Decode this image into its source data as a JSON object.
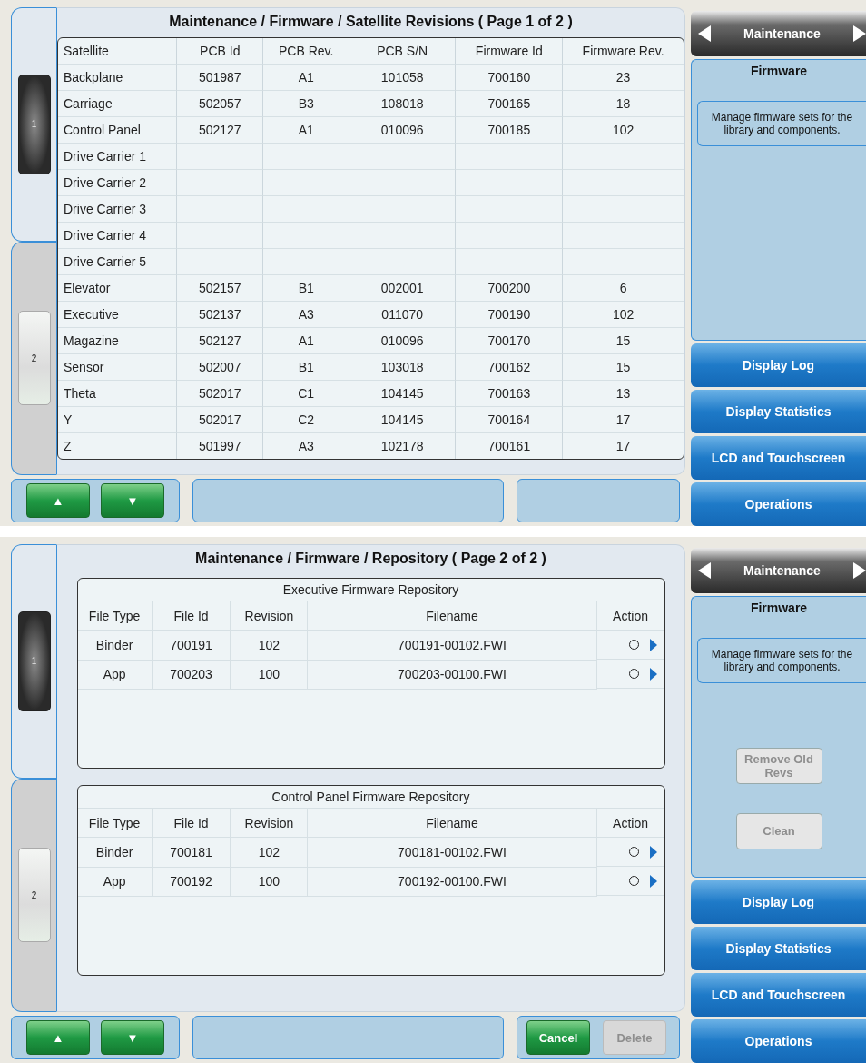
{
  "screens": [
    {
      "title": "Maintenance / Firmware / Satellite Revisions ( Page 1 of 2 )",
      "page_tabs": [
        {
          "label": "1",
          "selected": true
        },
        {
          "label": "2",
          "selected": false
        }
      ],
      "nav_buttons": [
        "▲",
        "▼"
      ],
      "content": {
        "kind": "table",
        "columns": [
          "Satellite",
          "PCB Id",
          "PCB Rev.",
          "PCB S/N",
          "Firmware Id",
          "Firmware Rev."
        ],
        "rows": [
          [
            "Backplane",
            "501987",
            "A1",
            "101058",
            "700160",
            "23"
          ],
          [
            "Carriage",
            "502057",
            "B3",
            "108018",
            "700165",
            "18"
          ],
          [
            "Control Panel",
            "502127",
            "A1",
            "010096",
            "700185",
            "102"
          ],
          [
            "Drive Carrier 1",
            "",
            "",
            "",
            "",
            ""
          ],
          [
            "Drive Carrier 2",
            "",
            "",
            "",
            "",
            ""
          ],
          [
            "Drive Carrier 3",
            "",
            "",
            "",
            "",
            ""
          ],
          [
            "Drive Carrier 4",
            "",
            "",
            "",
            "",
            ""
          ],
          [
            "Drive Carrier 5",
            "",
            "",
            "",
            "",
            ""
          ],
          [
            "Elevator",
            "502157",
            "B1",
            "002001",
            "700200",
            "6"
          ],
          [
            "Executive",
            "502137",
            "A3",
            "011070",
            "700190",
            "102"
          ],
          [
            "Magazine",
            "502127",
            "A1",
            "010096",
            "700170",
            "15"
          ],
          [
            "Sensor",
            "502007",
            "B1",
            "103018",
            "700162",
            "15"
          ],
          [
            "Theta",
            "502017",
            "C1",
            "104145",
            "700163",
            "13"
          ],
          [
            "Y",
            "502017",
            "C2",
            "104145",
            "700164",
            "17"
          ],
          [
            "Z",
            "501997",
            "A3",
            "102178",
            "700161",
            "17"
          ]
        ]
      },
      "side": {
        "section": "Maintenance",
        "heading": "Firmware",
        "description": "Manage firmware sets for the library and components.",
        "menu": [
          "Display Log",
          "Display Statistics",
          "LCD and Touchscreen",
          "Operations"
        ]
      }
    },
    {
      "title": "Maintenance / Firmware / Repository ( Page 2 of 2 )",
      "page_tabs": [
        {
          "label": "1",
          "selected": true
        },
        {
          "label": "2",
          "selected": false
        }
      ],
      "nav_buttons": [
        "▲",
        "▼"
      ],
      "content": {
        "kind": "repositories",
        "repositories": [
          {
            "title": "Executive Firmware Repository",
            "columns": [
              "File Type",
              "File Id",
              "Revision",
              "Filename",
              "Action"
            ],
            "rows": [
              {
                "cells": [
                  "Binder",
                  "700191",
                  "102",
                  "700191-00102.FWI"
                ],
                "selected": false
              },
              {
                "cells": [
                  "App",
                  "700203",
                  "100",
                  "700203-00100.FWI"
                ],
                "selected": false
              }
            ]
          },
          {
            "title": "Control Panel Firmware Repository",
            "columns": [
              "File Type",
              "File Id",
              "Revision",
              "Filename",
              "Action"
            ],
            "rows": [
              {
                "cells": [
                  "Binder",
                  "700181",
                  "102",
                  "700181-00102.FWI"
                ],
                "selected": false
              },
              {
                "cells": [
                  "App",
                  "700192",
                  "100",
                  "700192-00100.FWI"
                ],
                "selected": false
              }
            ]
          }
        ]
      },
      "footer_buttons": [
        {
          "label": "Cancel",
          "disabled": false
        },
        {
          "label": "Delete",
          "disabled": true
        }
      ],
      "side": {
        "section": "Maintenance",
        "heading": "Firmware",
        "description": "Manage firmware sets for the library and components.",
        "actions": [
          {
            "label": "Remove Old Revs",
            "disabled": true
          },
          {
            "label": "Clean",
            "disabled": true
          }
        ],
        "menu": [
          "Display Log",
          "Display Statistics",
          "LCD and Touchscreen",
          "Operations"
        ]
      }
    }
  ]
}
